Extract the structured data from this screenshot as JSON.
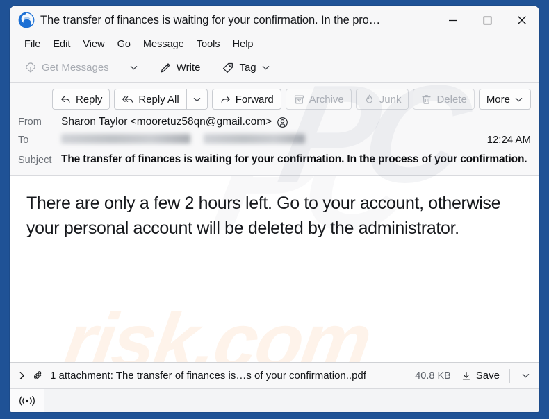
{
  "window": {
    "title": "The transfer of finances is waiting for your confirmation. In the pro…",
    "logo_icon": "thunderbird-logo-icon",
    "controls": {
      "minimize": "minimize-icon",
      "maximize": "maximize-icon",
      "close": "close-icon"
    },
    "frame_color": "#1f5296"
  },
  "menubar": {
    "items": [
      {
        "label": "File",
        "accel": "F"
      },
      {
        "label": "Edit",
        "accel": "E"
      },
      {
        "label": "View",
        "accel": "V"
      },
      {
        "label": "Go",
        "accel": "G"
      },
      {
        "label": "Message",
        "accel": "M"
      },
      {
        "label": "Tools",
        "accel": "T"
      },
      {
        "label": "Help",
        "accel": "H"
      }
    ]
  },
  "toolbar": {
    "get_messages_label": "Get Messages",
    "get_messages_icon": "cloud-download-icon",
    "get_messages_disabled": true,
    "get_messages_chevron_icon": "chevron-down-icon",
    "write_label": "Write",
    "write_icon": "pencil-icon",
    "tag_label": "Tag",
    "tag_icon": "tag-icon",
    "tag_chevron_icon": "chevron-down-icon"
  },
  "message_actions": {
    "reply_label": "Reply",
    "reply_icon": "reply-arrow-icon",
    "reply_all_label": "Reply All",
    "reply_all_icon": "reply-all-arrow-icon",
    "reply_all_chevron_icon": "chevron-down-icon",
    "forward_label": "Forward",
    "forward_icon": "forward-arrow-icon",
    "archive_label": "Archive",
    "archive_icon": "archive-box-icon",
    "archive_disabled": true,
    "junk_label": "Junk",
    "junk_icon": "flame-icon",
    "junk_disabled": true,
    "delete_label": "Delete",
    "delete_icon": "trash-icon",
    "delete_disabled": true,
    "more_label": "More",
    "more_chevron_icon": "chevron-down-icon"
  },
  "headers": {
    "from_label": "From",
    "from_value": "Sharon Taylor <mooretuz58qn@gmail.com>",
    "from_contact_icon": "contact-avatar-icon",
    "to_label": "To",
    "to_value_redacted": true,
    "time": "12:24 AM",
    "subject_label": "Subject",
    "subject_value": "The transfer of finances is waiting for your confirmation. In the process of your confirmation."
  },
  "body": {
    "text": "There are only a few 2 hours left. Go to your account, otherwise your personal account will be deleted by the administrator."
  },
  "attachment": {
    "expand_icon": "chevron-right-icon",
    "paperclip_icon": "paperclip-icon",
    "summary": "1 attachment: The transfer of finances is…s of your confirmation..pdf",
    "size": "40.8 KB",
    "save_label": "Save",
    "save_icon": "download-icon",
    "chevron_icon": "chevron-down-icon"
  },
  "statusbar": {
    "online_icon": "broadcast-signal-icon"
  },
  "watermarks": {
    "header": "PC",
    "body": "PC",
    "footer": "risk.com"
  }
}
